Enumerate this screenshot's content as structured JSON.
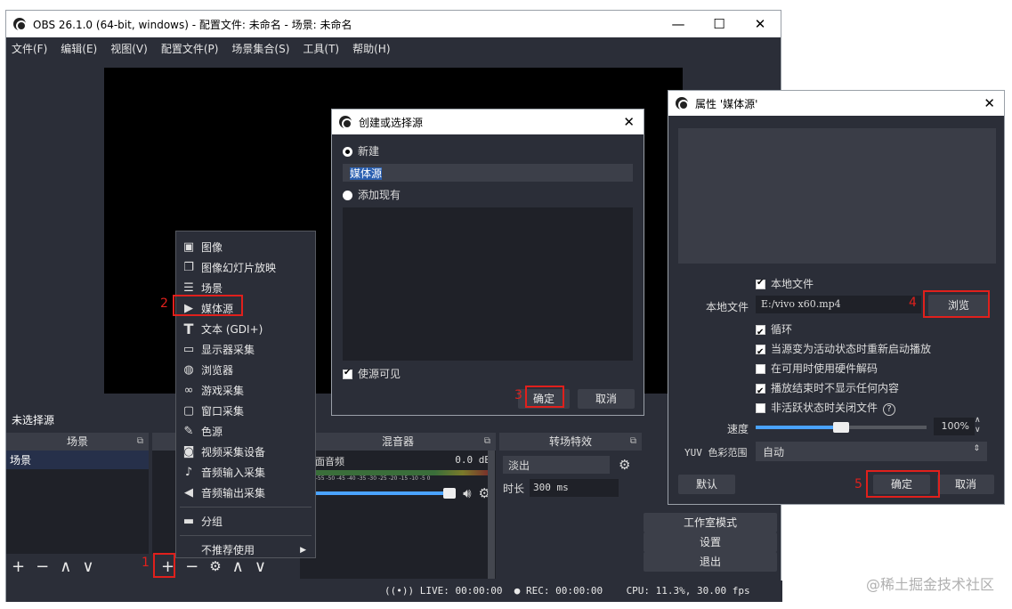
{
  "main_window": {
    "title": "OBS 26.1.0 (64-bit, windows) - 配置文件: 未命名 - 场景: 未命名",
    "window_controls": [
      "—",
      "☐",
      "✕"
    ],
    "menu": [
      "文件(F)",
      "编辑(E)",
      "视图(V)",
      "配置文件(P)",
      "场景集合(S)",
      "工具(T)",
      "帮助(H)"
    ],
    "no_source_selected": "未选择源",
    "docks": {
      "scenes": {
        "title": "场景",
        "items": [
          "场景"
        ]
      },
      "mixer": {
        "title": "混音器",
        "track_name": "桌面音频",
        "level": "0.0 dB",
        "scale": "-60 -55 -50 -45 -40 -35 -30 -25 -20 -15 -10 -5 0"
      },
      "transitions": {
        "title": "转场特效",
        "type": "淡出",
        "duration_label": "时长",
        "duration": "300 ms"
      },
      "controls": {
        "buttons": [
          "工作室模式",
          "设置",
          "退出"
        ]
      }
    },
    "status": {
      "live": "LIVE: 00:00:00",
      "rec": "REC: 00:00:00",
      "cpu": "CPU: 11.3%, 30.00 fps"
    }
  },
  "context_menu": {
    "items": [
      "图像",
      "图像幻灯片放映",
      "场景",
      "媒体源",
      "文本 (GDI+)",
      "显示器采集",
      "浏览器",
      "游戏采集",
      "窗口采集",
      "色源",
      "视频采集设备",
      "音频输入采集",
      "音频输出采集"
    ],
    "group": "分组",
    "deprecated": "不推荐使用",
    "icons": [
      "image-icon",
      "slideshow-icon",
      "list-icon",
      "play-icon",
      "text-icon",
      "monitor-icon",
      "globe-icon",
      "gamepad-icon",
      "window-icon",
      "brush-icon",
      "camera-icon",
      "mic-icon",
      "speaker-icon"
    ]
  },
  "create_dialog": {
    "title": "创建或选择源",
    "new_label": "新建",
    "name_value": "媒体源",
    "existing_label": "添加现有",
    "visible_label": "使源可见",
    "ok": "确定",
    "cancel": "取消"
  },
  "props_dialog": {
    "title": "属性 '媒体源'",
    "local_file": "本地文件",
    "file_label": "本地文件",
    "file_path": "E:/vivo x60.mp4",
    "browse": "浏览",
    "options": [
      {
        "label": "循环",
        "checked": true
      },
      {
        "label": "当源变为活动状态时重新启动播放",
        "checked": true
      },
      {
        "label": "在可用时使用硬件解码",
        "checked": false
      },
      {
        "label": "播放结束时不显示任何内容",
        "checked": true
      },
      {
        "label": "非活跃状态时关闭文件",
        "checked": false
      }
    ],
    "speed_label": "速度",
    "speed_value": "100%",
    "speed_fraction": 0.5,
    "yuv_label": "YUV 色彩范围",
    "yuv_value": "自动",
    "defaults": "默认",
    "ok": "确定",
    "cancel": "取消"
  },
  "annotations": [
    "1",
    "2",
    "3",
    "4",
    "5"
  ],
  "watermark": "@稀土掘金技术社区",
  "colors": {
    "accent_red": "#e0201c",
    "obs_bg": "#2b2e38",
    "slider_blue": "#4aa3ff"
  }
}
